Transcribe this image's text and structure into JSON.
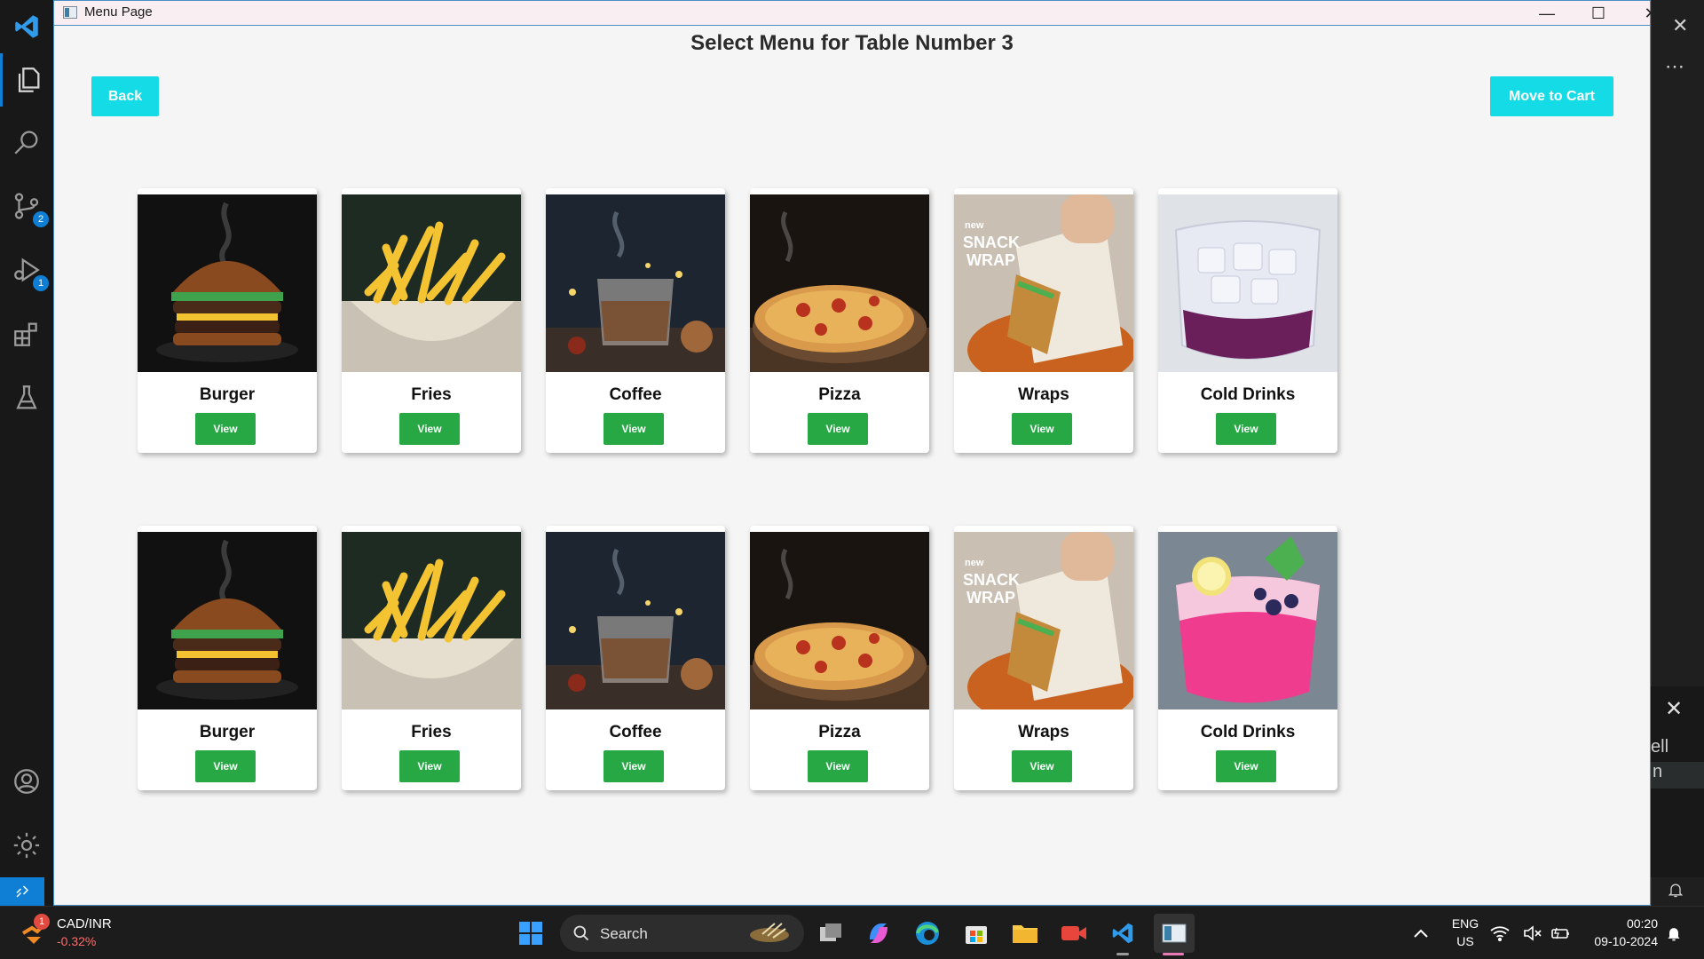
{
  "window": {
    "title": "Menu Page"
  },
  "page": {
    "heading": "Select Menu for Table Number 3",
    "back_label": "Back",
    "cart_label": "Move to Cart"
  },
  "menu": {
    "row1": [
      {
        "name": "Burger",
        "view": "View",
        "image": "burger"
      },
      {
        "name": "Fries",
        "view": "View",
        "image": "fries"
      },
      {
        "name": "Coffee",
        "view": "View",
        "image": "coffee"
      },
      {
        "name": "Pizza",
        "view": "View",
        "image": "pizza"
      },
      {
        "name": "Wraps",
        "view": "View",
        "image": "wrap"
      },
      {
        "name": "Cold Drinks",
        "view": "View",
        "image": "cold-drink-purple"
      }
    ],
    "row2": [
      {
        "name": "Burger",
        "view": "View",
        "image": "burger"
      },
      {
        "name": "Fries",
        "view": "View",
        "image": "fries"
      },
      {
        "name": "Coffee",
        "view": "View",
        "image": "coffee"
      },
      {
        "name": "Pizza",
        "view": "View",
        "image": "pizza"
      },
      {
        "name": "Wraps",
        "view": "View",
        "image": "wrap"
      },
      {
        "name": "Cold Drinks",
        "view": "View",
        "image": "cold-drink-pink"
      }
    ]
  },
  "wrap_image_text": {
    "line1": "new",
    "line2": "SNACK",
    "line3": "WRAP"
  },
  "vscode": {
    "scm_badge": "2",
    "debug_badge": "1",
    "panel_text1": "ell",
    "panel_text2": "n"
  },
  "taskbar": {
    "weather_badge": "1",
    "ticker": "CAD/INR",
    "ticker_change": "-0.32%",
    "search_label": "Search",
    "lang1": "ENG",
    "lang2": "US",
    "time": "00:20",
    "date": "09-10-2024"
  },
  "colors": {
    "accent_cyan": "#14dbe6",
    "view_green": "#27a844",
    "vscode_blue": "#0e7fd4"
  }
}
